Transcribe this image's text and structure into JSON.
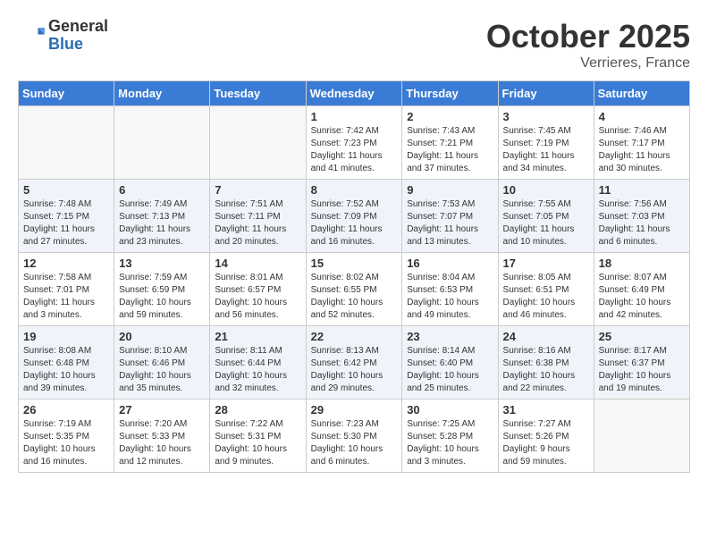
{
  "logo": {
    "general": "General",
    "blue": "Blue"
  },
  "title": "October 2025",
  "location": "Verrieres, France",
  "weekdays": [
    "Sunday",
    "Monday",
    "Tuesday",
    "Wednesday",
    "Thursday",
    "Friday",
    "Saturday"
  ],
  "weeks": [
    [
      {
        "day": "",
        "info": ""
      },
      {
        "day": "",
        "info": ""
      },
      {
        "day": "",
        "info": ""
      },
      {
        "day": "1",
        "info": "Sunrise: 7:42 AM\nSunset: 7:23 PM\nDaylight: 11 hours\nand 41 minutes."
      },
      {
        "day": "2",
        "info": "Sunrise: 7:43 AM\nSunset: 7:21 PM\nDaylight: 11 hours\nand 37 minutes."
      },
      {
        "day": "3",
        "info": "Sunrise: 7:45 AM\nSunset: 7:19 PM\nDaylight: 11 hours\nand 34 minutes."
      },
      {
        "day": "4",
        "info": "Sunrise: 7:46 AM\nSunset: 7:17 PM\nDaylight: 11 hours\nand 30 minutes."
      }
    ],
    [
      {
        "day": "5",
        "info": "Sunrise: 7:48 AM\nSunset: 7:15 PM\nDaylight: 11 hours\nand 27 minutes."
      },
      {
        "day": "6",
        "info": "Sunrise: 7:49 AM\nSunset: 7:13 PM\nDaylight: 11 hours\nand 23 minutes."
      },
      {
        "day": "7",
        "info": "Sunrise: 7:51 AM\nSunset: 7:11 PM\nDaylight: 11 hours\nand 20 minutes."
      },
      {
        "day": "8",
        "info": "Sunrise: 7:52 AM\nSunset: 7:09 PM\nDaylight: 11 hours\nand 16 minutes."
      },
      {
        "day": "9",
        "info": "Sunrise: 7:53 AM\nSunset: 7:07 PM\nDaylight: 11 hours\nand 13 minutes."
      },
      {
        "day": "10",
        "info": "Sunrise: 7:55 AM\nSunset: 7:05 PM\nDaylight: 11 hours\nand 10 minutes."
      },
      {
        "day": "11",
        "info": "Sunrise: 7:56 AM\nSunset: 7:03 PM\nDaylight: 11 hours\nand 6 minutes."
      }
    ],
    [
      {
        "day": "12",
        "info": "Sunrise: 7:58 AM\nSunset: 7:01 PM\nDaylight: 11 hours\nand 3 minutes."
      },
      {
        "day": "13",
        "info": "Sunrise: 7:59 AM\nSunset: 6:59 PM\nDaylight: 10 hours\nand 59 minutes."
      },
      {
        "day": "14",
        "info": "Sunrise: 8:01 AM\nSunset: 6:57 PM\nDaylight: 10 hours\nand 56 minutes."
      },
      {
        "day": "15",
        "info": "Sunrise: 8:02 AM\nSunset: 6:55 PM\nDaylight: 10 hours\nand 52 minutes."
      },
      {
        "day": "16",
        "info": "Sunrise: 8:04 AM\nSunset: 6:53 PM\nDaylight: 10 hours\nand 49 minutes."
      },
      {
        "day": "17",
        "info": "Sunrise: 8:05 AM\nSunset: 6:51 PM\nDaylight: 10 hours\nand 46 minutes."
      },
      {
        "day": "18",
        "info": "Sunrise: 8:07 AM\nSunset: 6:49 PM\nDaylight: 10 hours\nand 42 minutes."
      }
    ],
    [
      {
        "day": "19",
        "info": "Sunrise: 8:08 AM\nSunset: 6:48 PM\nDaylight: 10 hours\nand 39 minutes."
      },
      {
        "day": "20",
        "info": "Sunrise: 8:10 AM\nSunset: 6:46 PM\nDaylight: 10 hours\nand 35 minutes."
      },
      {
        "day": "21",
        "info": "Sunrise: 8:11 AM\nSunset: 6:44 PM\nDaylight: 10 hours\nand 32 minutes."
      },
      {
        "day": "22",
        "info": "Sunrise: 8:13 AM\nSunset: 6:42 PM\nDaylight: 10 hours\nand 29 minutes."
      },
      {
        "day": "23",
        "info": "Sunrise: 8:14 AM\nSunset: 6:40 PM\nDaylight: 10 hours\nand 25 minutes."
      },
      {
        "day": "24",
        "info": "Sunrise: 8:16 AM\nSunset: 6:38 PM\nDaylight: 10 hours\nand 22 minutes."
      },
      {
        "day": "25",
        "info": "Sunrise: 8:17 AM\nSunset: 6:37 PM\nDaylight: 10 hours\nand 19 minutes."
      }
    ],
    [
      {
        "day": "26",
        "info": "Sunrise: 7:19 AM\nSunset: 5:35 PM\nDaylight: 10 hours\nand 16 minutes."
      },
      {
        "day": "27",
        "info": "Sunrise: 7:20 AM\nSunset: 5:33 PM\nDaylight: 10 hours\nand 12 minutes."
      },
      {
        "day": "28",
        "info": "Sunrise: 7:22 AM\nSunset: 5:31 PM\nDaylight: 10 hours\nand 9 minutes."
      },
      {
        "day": "29",
        "info": "Sunrise: 7:23 AM\nSunset: 5:30 PM\nDaylight: 10 hours\nand 6 minutes."
      },
      {
        "day": "30",
        "info": "Sunrise: 7:25 AM\nSunset: 5:28 PM\nDaylight: 10 hours\nand 3 minutes."
      },
      {
        "day": "31",
        "info": "Sunrise: 7:27 AM\nSunset: 5:26 PM\nDaylight: 9 hours\nand 59 minutes."
      },
      {
        "day": "",
        "info": ""
      }
    ]
  ]
}
